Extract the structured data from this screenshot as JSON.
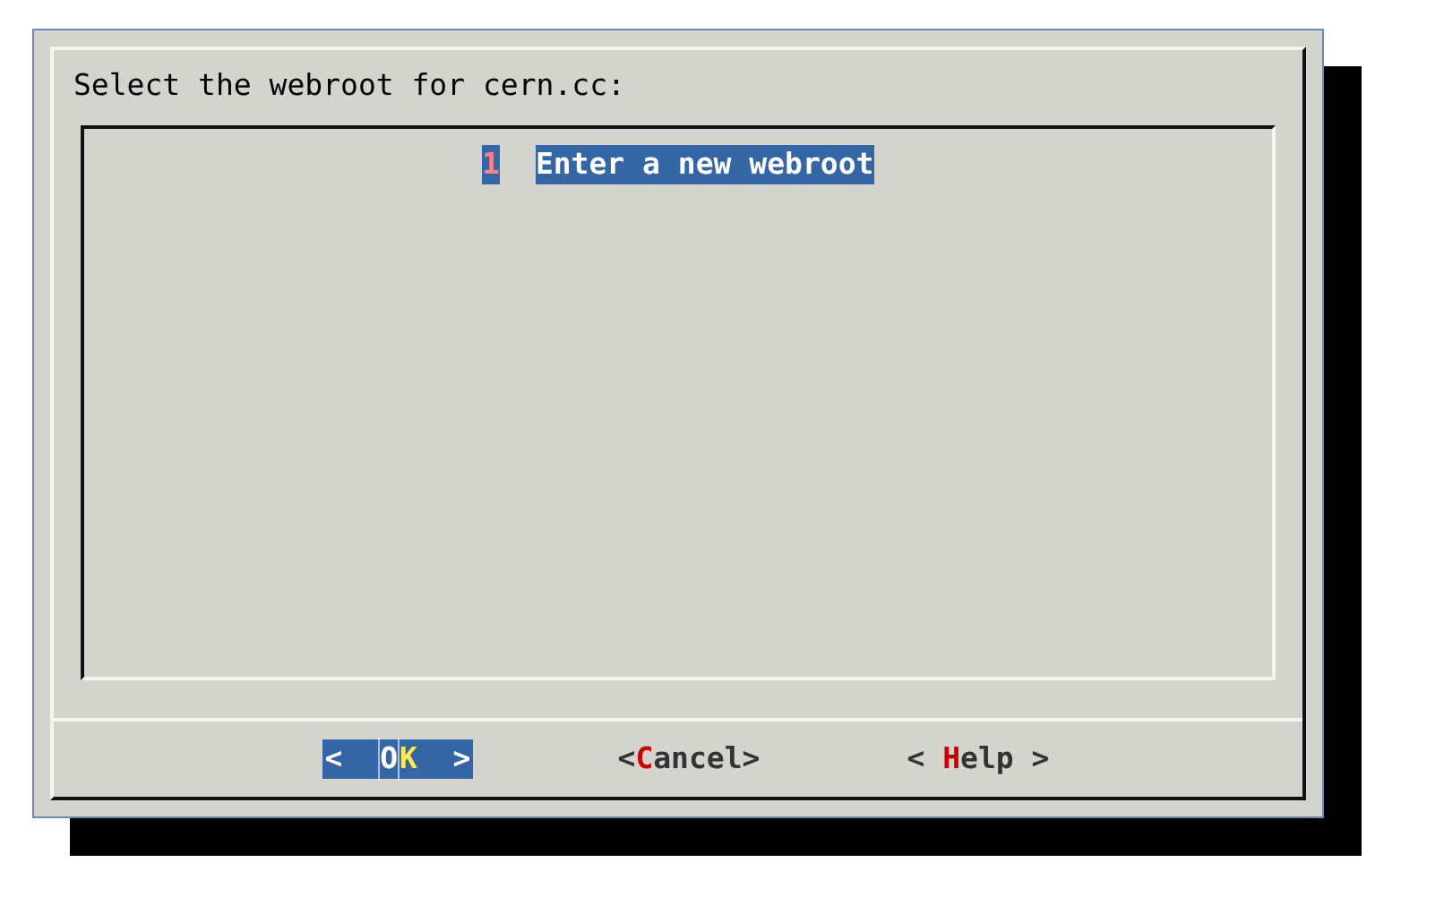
{
  "dialog": {
    "prompt": "Select the webroot for cern.cc:"
  },
  "menu": {
    "items": [
      {
        "tag": "1",
        "label": "Enter a new webroot",
        "selected": true
      }
    ]
  },
  "buttons": [
    {
      "open": "<",
      "before": "O",
      "hotkey": "K",
      "close": ">",
      "selected": true
    },
    {
      "open": "<",
      "hotkey": "C",
      "after": "ancel",
      "close": ">",
      "selected": false
    },
    {
      "open": "<",
      "hotkey": "H",
      "after": "elp",
      "close": ">",
      "selected": false
    }
  ]
}
